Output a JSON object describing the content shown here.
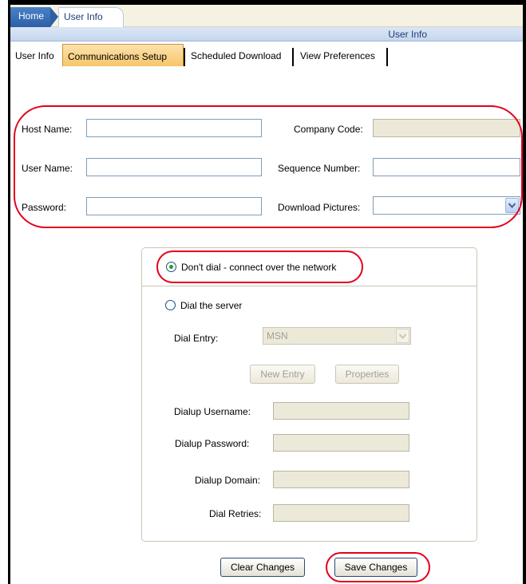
{
  "breadcrumb": {
    "home": "Home",
    "current": "User Info"
  },
  "page_title": "User Info",
  "tabs": [
    {
      "label": "User Info",
      "active": false
    },
    {
      "label": "Communications Setup",
      "active": true
    },
    {
      "label": "Scheduled Download",
      "active": false
    },
    {
      "label": "View Preferences",
      "active": false
    }
  ],
  "form": {
    "host_name": {
      "label": "Host Name:",
      "value": ""
    },
    "user_name": {
      "label": "User Name:",
      "value": ""
    },
    "password": {
      "label": "Password:",
      "value": ""
    },
    "company_code": {
      "label": "Company Code:",
      "value": "",
      "disabled": true
    },
    "sequence_number": {
      "label": "Sequence Number:",
      "value": ""
    },
    "download_pictures": {
      "label": "Download Pictures:",
      "value": ""
    }
  },
  "connection": {
    "network_option": {
      "label": "Don't dial - connect over the network",
      "selected": true
    },
    "dial_option": {
      "label": "Dial the server",
      "selected": false
    },
    "dial_entry": {
      "label": "Dial Entry:",
      "value": "MSN"
    },
    "new_entry_button": "New Entry",
    "properties_button": "Properties",
    "dialup_username": {
      "label": "Dialup Username:",
      "value": ""
    },
    "dialup_password": {
      "label": "Dialup Password:",
      "value": ""
    },
    "dialup_domain": {
      "label": "Dialup Domain:",
      "value": ""
    },
    "dial_retries": {
      "label": "Dial Retries:",
      "value": ""
    }
  },
  "actions": {
    "clear": "Clear Changes",
    "save": "Save Changes"
  },
  "colors": {
    "highlight": "#e3001b",
    "active_tab": "#f6c56a",
    "header_blue": "#2c5fa6",
    "disabled_field": "#ece9d8"
  },
  "icons": {
    "dropdown": "chevron-down-icon",
    "radio_selected": "radio-selected-icon",
    "radio_unselected": "radio-unselected-icon"
  }
}
